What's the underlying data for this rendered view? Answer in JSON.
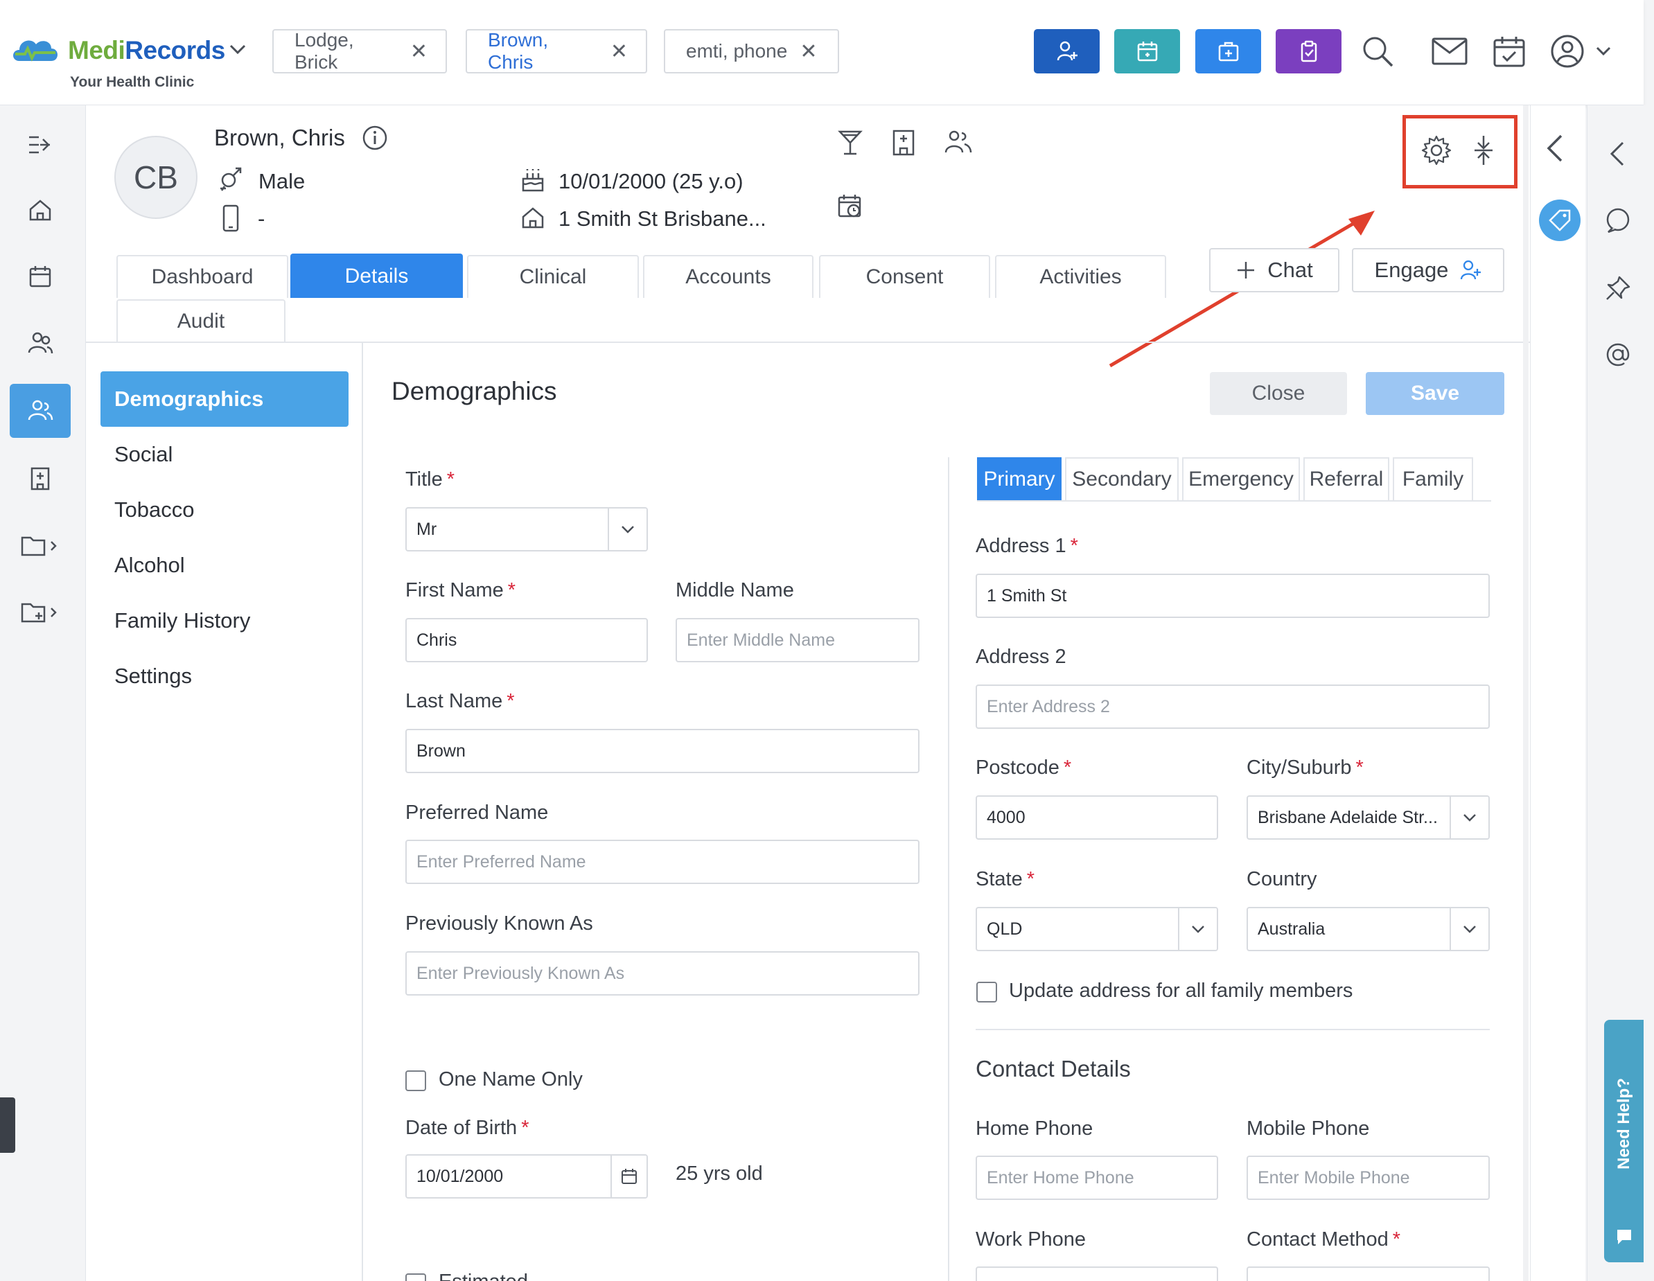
{
  "brand": {
    "name_part1": "Medi",
    "name_part2": "Records",
    "subtitle": "Your Health Clinic"
  },
  "patient_tabs": [
    {
      "label": "Lodge, Brick"
    },
    {
      "label": "Brown, Chris"
    },
    {
      "label": "emti, phone"
    }
  ],
  "quick_actions": [
    {
      "icon": "add-patient-icon",
      "color": "#1f5fbd"
    },
    {
      "icon": "appointment-icon",
      "color": "#36a9b5"
    },
    {
      "icon": "medical-kit-icon",
      "color": "#2f86ea"
    },
    {
      "icon": "clipboard-icon",
      "color": "#7b3fbf"
    }
  ],
  "patient": {
    "initials": "CB",
    "name": "Brown, Chris",
    "gender": "Male",
    "phone": "-",
    "dob_display": "10/01/2000 (25 y.o)",
    "address_display": "1 Smith St Brisbane..."
  },
  "tabs": [
    "Dashboard",
    "Details",
    "Clinical",
    "Accounts",
    "Consent",
    "Activities",
    "Audit"
  ],
  "chat_label": "Chat",
  "engage_label": "Engage",
  "side_menu": [
    "Demographics",
    "Social",
    "Tobacco",
    "Alcohol",
    "Family History",
    "Settings"
  ],
  "form": {
    "title": "Demographics",
    "close_label": "Close",
    "save_label": "Save",
    "title_label": "Title",
    "title_value": "Mr",
    "first_name_label": "First Name",
    "first_name_value": "Chris",
    "middle_name_label": "Middle Name",
    "middle_name_placeholder": "Enter Middle Name",
    "last_name_label": "Last Name",
    "last_name_value": "Brown",
    "preferred_name_label": "Preferred Name",
    "preferred_name_placeholder": "Enter Preferred Name",
    "previously_known_label": "Previously Known As",
    "previously_known_placeholder": "Enter Previously Known As",
    "one_name_only_label": "One Name Only",
    "dob_label": "Date of Birth",
    "dob_value": "10/01/2000",
    "age_text": "25 yrs old",
    "estimated_label": "Estimated"
  },
  "address": {
    "tabs": [
      "Primary",
      "Secondary",
      "Emergency",
      "Referral",
      "Family"
    ],
    "address1_label": "Address 1",
    "address1_value": "1 Smith St",
    "address2_label": "Address 2",
    "address2_placeholder": "Enter Address 2",
    "postcode_label": "Postcode",
    "postcode_value": "4000",
    "city_label": "City/Suburb",
    "city_value": "Brisbane Adelaide Str...",
    "state_label": "State",
    "state_value": "QLD",
    "country_label": "Country",
    "country_value": "Australia",
    "update_family_label": "Update address for all family members"
  },
  "contact": {
    "title": "Contact Details",
    "home_phone_label": "Home Phone",
    "home_phone_placeholder": "Enter Home Phone",
    "mobile_phone_label": "Mobile Phone",
    "mobile_phone_placeholder": "Enter Mobile Phone",
    "work_phone_label": "Work Phone",
    "contact_method_label": "Contact Method"
  },
  "help_label": "Need Help?",
  "colors": {
    "primary": "#2f86ea",
    "accent_light": "#4aa3e6",
    "annotation": "#e0402d",
    "required": "#d9263a"
  }
}
